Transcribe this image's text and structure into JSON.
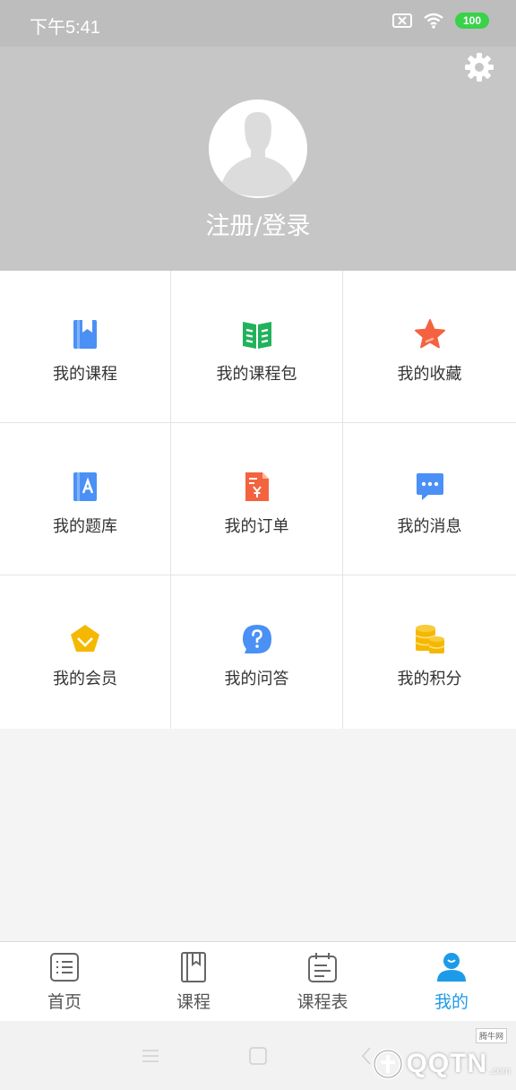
{
  "status_bar": {
    "time": "下午5:41",
    "battery": "100"
  },
  "profile": {
    "login_text": "注册/登录"
  },
  "grid": {
    "items": [
      {
        "label": "我的课程",
        "icon": "course-book-icon",
        "color": "#4a90f5"
      },
      {
        "label": "我的课程包",
        "icon": "open-book-icon",
        "color": "#22b25c"
      },
      {
        "label": "我的收藏",
        "icon": "star-icon",
        "color": "#f4633f"
      },
      {
        "label": "我的题库",
        "icon": "question-bank-icon",
        "color": "#4a90f5"
      },
      {
        "label": "我的订单",
        "icon": "order-icon",
        "color": "#f4633f"
      },
      {
        "label": "我的消息",
        "icon": "message-icon",
        "color": "#4a90f5"
      },
      {
        "label": "我的会员",
        "icon": "member-badge-icon",
        "color": "#f5b800"
      },
      {
        "label": "我的问答",
        "icon": "question-icon",
        "color": "#4a90f5"
      },
      {
        "label": "我的积分",
        "icon": "coins-icon",
        "color": "#f5b800"
      }
    ]
  },
  "tabs": [
    {
      "label": "首页",
      "icon": "home-list-icon",
      "active": false
    },
    {
      "label": "课程",
      "icon": "course-book-icon",
      "active": false
    },
    {
      "label": "课程表",
      "icon": "schedule-icon",
      "active": false
    },
    {
      "label": "我的",
      "icon": "user-icon",
      "active": true
    }
  ],
  "colors": {
    "accent": "#1e9be8",
    "header_bg": "#c6c6c6",
    "status_bg": "#bdbdbd"
  },
  "watermark": {
    "text": "QQTN",
    "suffix": ".com",
    "tag": "腾牛网"
  }
}
